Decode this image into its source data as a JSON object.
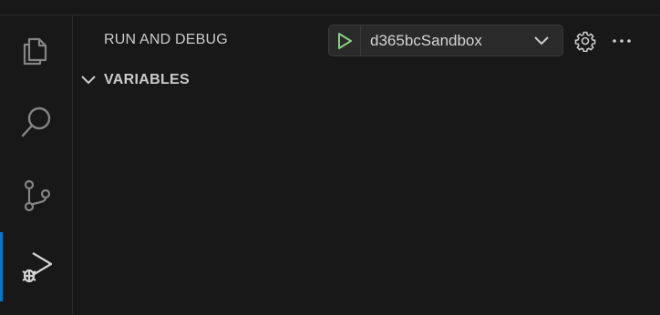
{
  "activity_bar": {
    "items": [
      {
        "name": "explorer",
        "icon": "files-icon"
      },
      {
        "name": "search",
        "icon": "search-icon"
      },
      {
        "name": "source-control",
        "icon": "source-control-icon"
      },
      {
        "name": "run-and-debug",
        "icon": "run-debug-icon",
        "active": true
      }
    ]
  },
  "sidebar": {
    "title": "RUN AND DEBUG",
    "config": {
      "selected": "d365bcSandbox"
    },
    "sections": [
      {
        "label": "VARIABLES",
        "expanded": true
      }
    ]
  },
  "colors": {
    "background": "#181818",
    "active_indicator": "#0078d4",
    "run_icon": "#89d185"
  }
}
